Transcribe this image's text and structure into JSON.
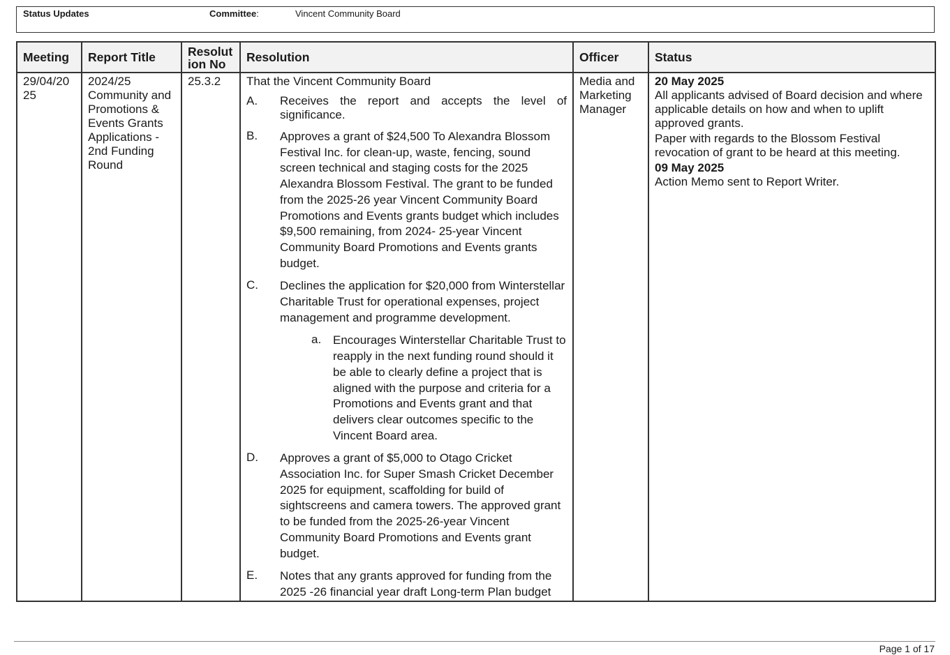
{
  "header": {
    "status_updates_label": "Status Updates",
    "committee_label": "Committee",
    "committee_colon": ":",
    "committee_value": "Vincent Community Board"
  },
  "table": {
    "columns": [
      "Meeting",
      "Report Title",
      "Resolut ion No",
      "Resolution",
      "Officer",
      "Status"
    ],
    "row": {
      "meeting": "29/04/20 25",
      "report_title": "2024/25 Community and Promotions & Events Grants Applications - 2nd Funding Round",
      "resolution_no": "25.3.2",
      "resolution": {
        "intro": "That the Vincent Community Board",
        "items": [
          {
            "marker": "A.",
            "text": "Receives the report and accepts the level of significance."
          },
          {
            "marker": "B.",
            "text": "Approves a grant of $24,500 To Alexandra Blossom Festival Inc. for clean-up, waste, fencing, sound screen technical and staging costs for the 2025 Alexandra Blossom Festival. The grant to be funded from the 2025-26 year Vincent Community Board Promotions and Events grants budget which includes $9,500 remaining, from 2024- 25-year Vincent Community Board Promotions and Events grants budget."
          },
          {
            "marker": "C.",
            "text": "Declines the application for $20,000 from Winterstellar Charitable Trust for operational expenses, project management and programme development."
          },
          {
            "marker": "D.",
            "text": "Approves a grant of $5,000 to Otago Cricket Association Inc. for Super Smash Cricket December 2025 for equipment, scaffolding for build of sightscreens and camera towers. The approved grant to be funded from the 2025-26-year Vincent Community Board Promotions and Events grant budget."
          },
          {
            "marker": "E.",
            "text": "Notes that any grants approved for funding from the 2025 -26 financial year draft Long-term Plan budget"
          }
        ],
        "sub_item": {
          "marker": "a.",
          "text": "Encourages Winterstellar Charitable Trust to reapply in the next funding round should it be able to clearly define a project that is aligned with the purpose and criteria for a Promotions and Events grant and that delivers clear outcomes specific to the Vincent Board area."
        }
      },
      "officer": "Media and Marketing Manager",
      "status": [
        {
          "date": "20 May 2025",
          "lines": [
            "All applicants advised of Board decision and where applicable details on how and when to uplift approved grants.",
            "Paper with regards to the Blossom Festival revocation of grant to be heard at this meeting."
          ]
        },
        {
          "date": "09 May 2025",
          "lines": [
            "Action Memo sent to Report Writer."
          ]
        }
      ]
    }
  },
  "footer": {
    "page_number": "Page 1 of 17"
  }
}
